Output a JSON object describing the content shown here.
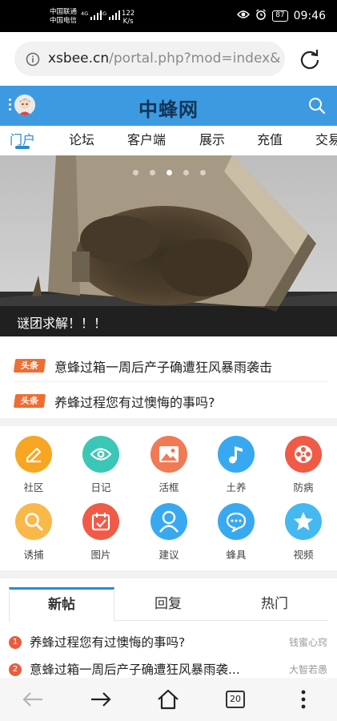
{
  "status_bar": {
    "carrier_1": "中国联通",
    "carrier_2": "中国电信",
    "signal_1_label": "4G",
    "signal_2_label": "4G",
    "speed_value": "122",
    "speed_unit": "K/s",
    "battery": "87",
    "time": "09:46",
    "icons": [
      "eye-icon",
      "alarm-icon"
    ]
  },
  "browser": {
    "url_host": "xsbee.cn",
    "url_path": "/portal.php?mod=index&r"
  },
  "site": {
    "logo": "中蜂网"
  },
  "nav": {
    "tabs": [
      "门户",
      "论坛",
      "客户端",
      "展示",
      "充值",
      "交易"
    ],
    "active": "门户"
  },
  "banner": {
    "caption": "谜团求解！！！",
    "slide_count": 5,
    "active_slide": 3
  },
  "headlines": [
    {
      "tag": "头条",
      "title": "意蜂过箱一周后产子确遭狂风暴雨袭击"
    },
    {
      "tag": "头条",
      "title": "养蜂过程您有过懊悔的事吗?"
    }
  ],
  "grid": [
    {
      "label": "社区",
      "icon": "edit-icon",
      "color": "#f6a623"
    },
    {
      "label": "日记",
      "icon": "eye-icon",
      "color": "#3cc6b6"
    },
    {
      "label": "活框",
      "icon": "image-icon",
      "color": "#f07a54"
    },
    {
      "label": "土养",
      "icon": "music-note-icon",
      "color": "#38a9f0"
    },
    {
      "label": "防病",
      "icon": "film-reel-icon",
      "color": "#f05a47"
    },
    {
      "label": "诱捕",
      "icon": "magnifier-icon",
      "color": "#f8b94a"
    },
    {
      "label": "图片",
      "icon": "calendar-icon",
      "color": "#f05a47"
    },
    {
      "label": "建议",
      "icon": "user-icon",
      "color": "#38a9f0"
    },
    {
      "label": "蜂具",
      "icon": "chat-bubble-icon",
      "color": "#38a9f0"
    },
    {
      "label": "视频",
      "icon": "star-icon",
      "color": "#45b8f0"
    }
  ],
  "feed": {
    "tabs": [
      "新帖",
      "回复",
      "热门"
    ],
    "active": "新帖",
    "posts": [
      {
        "rank": "1",
        "title": "养蜂过程您有过懊悔的事吗?",
        "author": "钱蜜心窍"
      },
      {
        "rank": "2",
        "title": "意蜂过箱一周后产子确遭狂风暴雨袭...",
        "author": "大智若愚"
      }
    ]
  },
  "bottom_bar": {
    "tab_count": "20"
  },
  "colors": {
    "header_blue": "#3d9ae0",
    "accent": "#2a8ad4",
    "tag_orange": "#ee6e32"
  }
}
